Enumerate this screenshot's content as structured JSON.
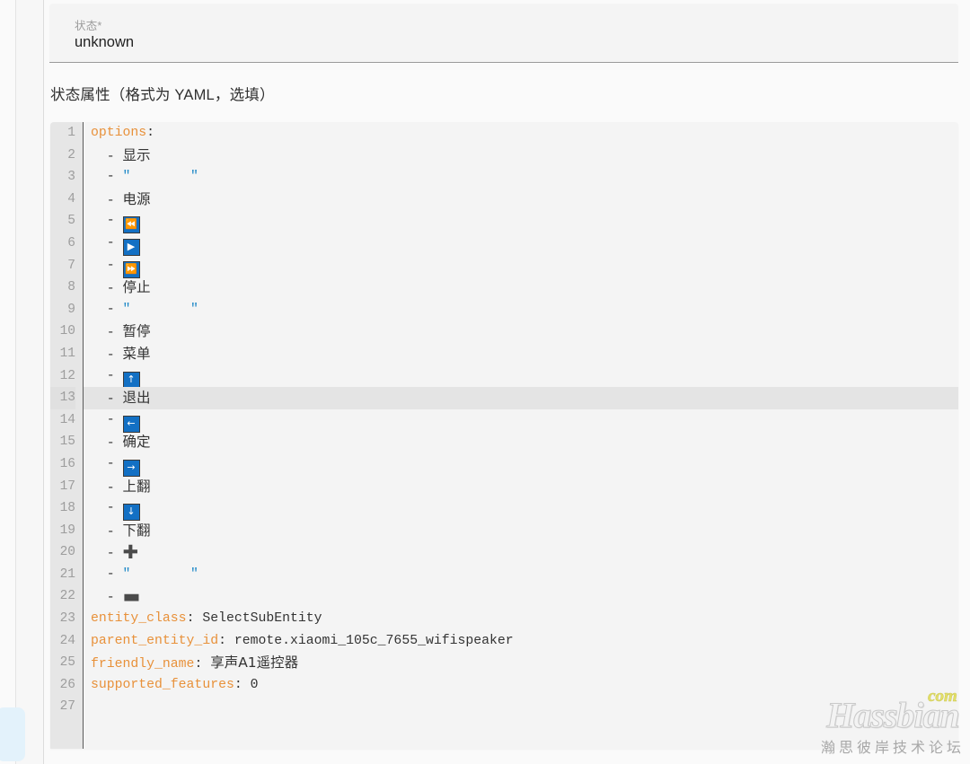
{
  "state_field": {
    "label": "状态*",
    "value": "unknown"
  },
  "section": {
    "title": "状态属性（格式为 YAML，选填）"
  },
  "editor": {
    "active_line": 13,
    "colors": {
      "key": "#e8913a",
      "string": "#1e88c7",
      "emoji_tile": "#1370c4",
      "gutter_bg": "#e6e6e6",
      "editor_bg": "#f4f4f4",
      "active_line_bg": "#e4e4e4"
    },
    "lines": [
      {
        "n": "1",
        "kind": "mapping",
        "key": "options",
        "value": ""
      },
      {
        "n": "2",
        "kind": "item",
        "text": "显示"
      },
      {
        "n": "3",
        "kind": "item_quoted",
        "text": ""
      },
      {
        "n": "4",
        "kind": "item",
        "text": "电源"
      },
      {
        "n": "5",
        "kind": "item_emoji",
        "glyph": "⏪",
        "icon": "rewind-emoji"
      },
      {
        "n": "6",
        "kind": "item_emoji",
        "glyph": "▶",
        "icon": "play-emoji"
      },
      {
        "n": "7",
        "kind": "item_emoji",
        "glyph": "⏩",
        "icon": "fast-forward-emoji"
      },
      {
        "n": "8",
        "kind": "item",
        "text": "停止"
      },
      {
        "n": "9",
        "kind": "item_quoted",
        "text": ""
      },
      {
        "n": "10",
        "kind": "item",
        "text": "暂停"
      },
      {
        "n": "11",
        "kind": "item",
        "text": "菜单"
      },
      {
        "n": "12",
        "kind": "item_emoji",
        "glyph": "↑",
        "icon": "arrow-up-emoji"
      },
      {
        "n": "13",
        "kind": "item",
        "text": "退出"
      },
      {
        "n": "14",
        "kind": "item_emoji",
        "glyph": "←",
        "icon": "arrow-left-emoji"
      },
      {
        "n": "15",
        "kind": "item",
        "text": "确定"
      },
      {
        "n": "16",
        "kind": "item_emoji",
        "glyph": "→",
        "icon": "arrow-right-emoji"
      },
      {
        "n": "17",
        "kind": "item",
        "text": "上翻"
      },
      {
        "n": "18",
        "kind": "item_emoji",
        "glyph": "↓",
        "icon": "arrow-down-emoji"
      },
      {
        "n": "19",
        "kind": "item",
        "text": "下翻"
      },
      {
        "n": "20",
        "kind": "item_glyph",
        "glyph": "✚",
        "icon": "heavy-plus-sign"
      },
      {
        "n": "21",
        "kind": "item_quoted",
        "text": ""
      },
      {
        "n": "22",
        "kind": "item_glyph",
        "glyph": "▬",
        "icon": "heavy-minus-sign"
      },
      {
        "n": "23",
        "kind": "mapping",
        "key": "entity_class",
        "value": "SelectSubEntity"
      },
      {
        "n": "24",
        "kind": "mapping",
        "key": "parent_entity_id",
        "value": "remote.xiaomi_105c_7655_wifispeaker"
      },
      {
        "n": "25",
        "kind": "mapping_cjk",
        "key": "friendly_name",
        "value": "享声A1遥控器"
      },
      {
        "n": "26",
        "kind": "mapping",
        "key": "supported_features",
        "value": "0"
      },
      {
        "n": "27",
        "kind": "blank",
        "text": ""
      }
    ]
  },
  "watermark": {
    "brand": "Hassbian",
    "tld": "com",
    "subtitle": "瀚思彼岸技术论坛"
  }
}
